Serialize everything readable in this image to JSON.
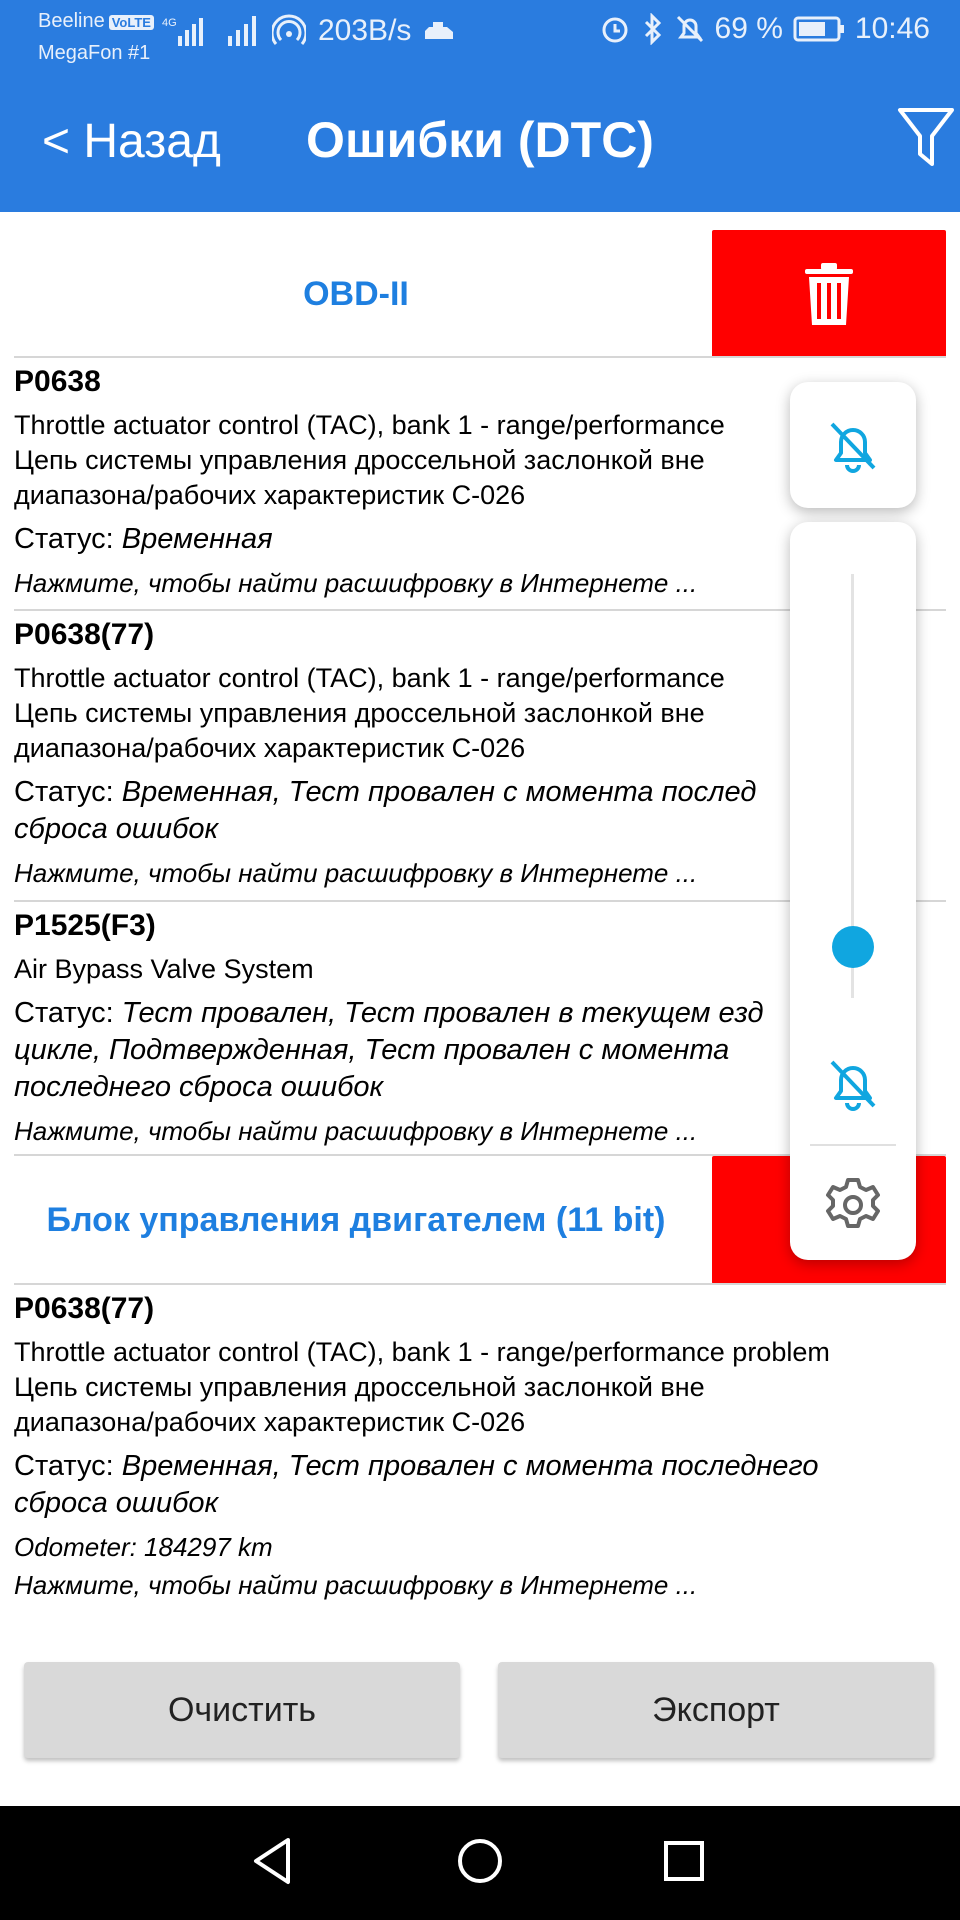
{
  "status_bar": {
    "carrier1": "Beeline",
    "volte": "VoLTE",
    "network_type": "4G",
    "carrier2": "MegaFon #1",
    "speed": "203B/s",
    "battery": "69 %",
    "time": "10:46"
  },
  "app_bar": {
    "back_label": "< Назад",
    "title": "Ошибки (DTC)"
  },
  "sections": [
    {
      "title": "OBD-II",
      "entries": [
        {
          "code": "P0638",
          "description": "Throttle actuator control (TAC), bank 1 - range/performance\nЦепь системы управления дроссельной заслонкой вне\nдиапазона/рабочих характеристик С-026",
          "status_label": "Статус: ",
          "status_value": "Временная",
          "link": "Нажмите, чтобы найти расшифровку в Интернете ..."
        },
        {
          "code": "P0638(77)",
          "description": "Throttle actuator control (TAC), bank 1 - range/performance\nЦепь системы управления дроссельной заслонкой вне\nдиапазона/рабочих характеристик С-026",
          "status_label": "Статус: ",
          "status_value": "Временная, Тест провален с момента послед\nсброса ошибок",
          "link": "Нажмите, чтобы найти расшифровку в Интернете ..."
        },
        {
          "code": "P1525(F3)",
          "description": "Air Bypass Valve System",
          "status_label": "Статус: ",
          "status_value": "Тест провален, Тест провален в текущем езд\nцикле, Подтвержденная, Тест провален с момента\nпоследнего сброса ошибок",
          "link": "Нажмите, чтобы найти расшифровку в Интернете ..."
        }
      ]
    },
    {
      "title": "Блок управления двигателем (11 bit)",
      "entries": [
        {
          "code": "P0638(77)",
          "description": "Throttle actuator control (TAC), bank 1 - range/performance problem\nЦепь системы управления дроссельной заслонкой вне\nдиапазона/рабочих характеристик С-026",
          "status_label": "Статус: ",
          "status_value": "Временная, Тест провален с момента последнего\nсброса ошибок",
          "odometer": "Odometer: 184297 km",
          "link": "Нажмите, чтобы найти расшифровку в Интернете ..."
        }
      ]
    }
  ],
  "buttons": {
    "clear": "Очистить",
    "export": "Экспорт"
  },
  "volume_panel": {
    "level": 0.12
  },
  "colors": {
    "app_bar": "#2a7cdf",
    "section_title": "#1e7fe0",
    "delete": "#ff0000",
    "slider": "#10a6e0"
  }
}
